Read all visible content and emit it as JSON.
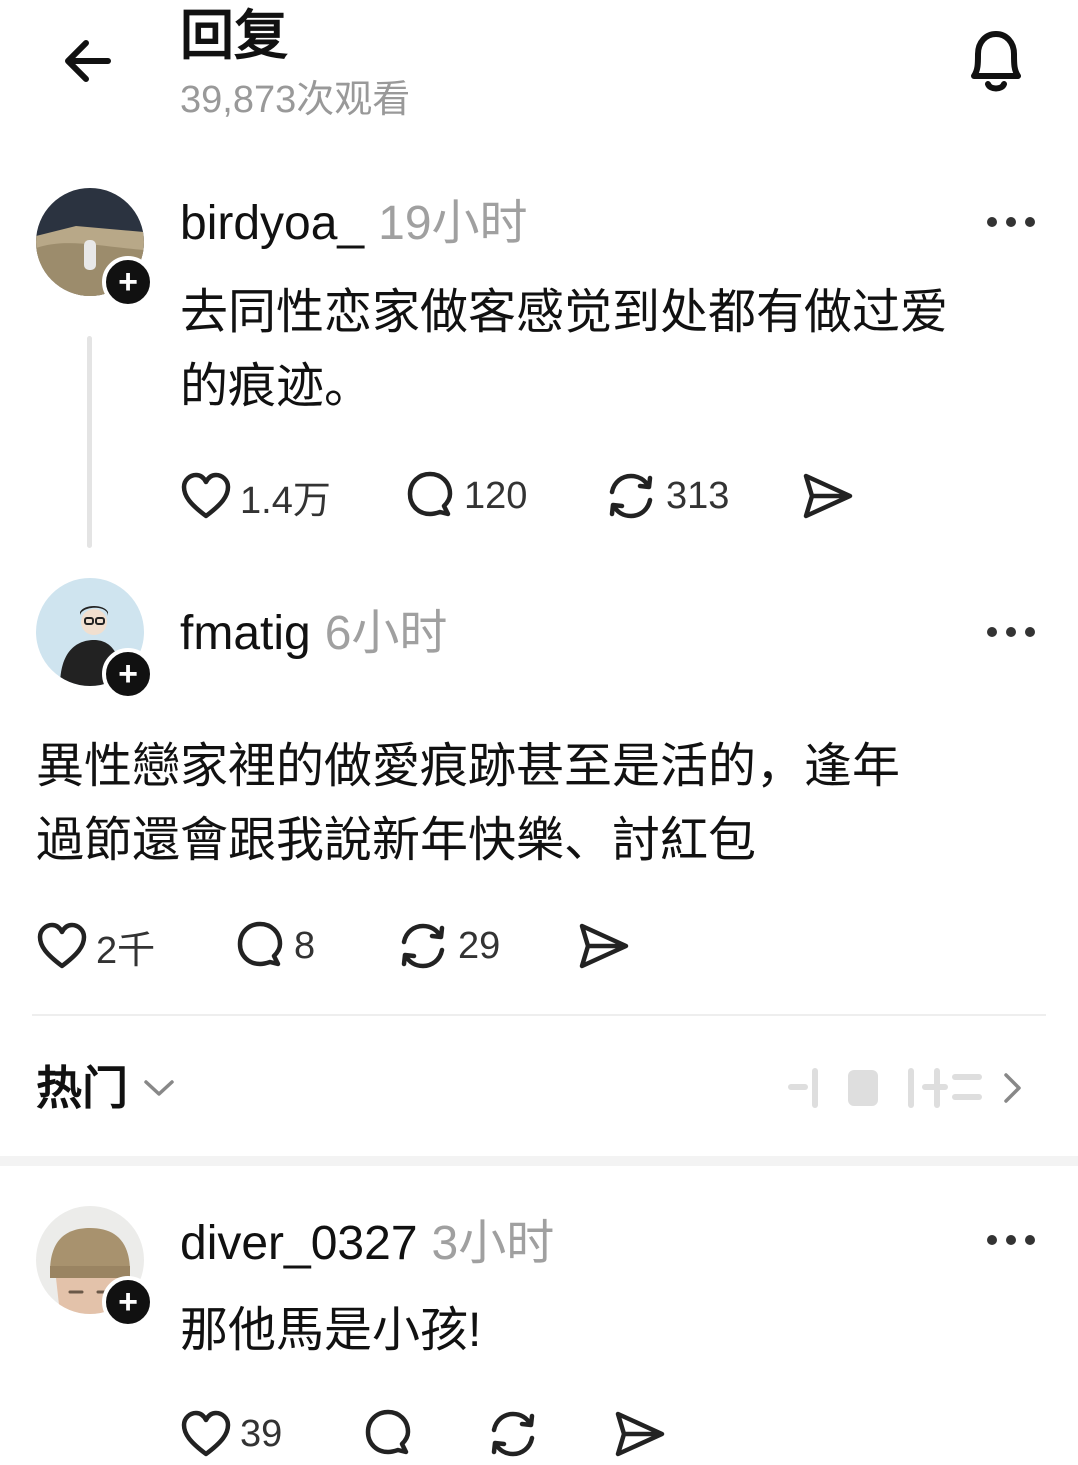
{
  "header": {
    "title": "回复",
    "views": "39,873次观看"
  },
  "posts": [
    {
      "username": "birdyoa_",
      "time": "19小时",
      "text_lines": [
        "去同性恋家做客感觉到处都有做过爱",
        "的痕迹。"
      ],
      "likes": "1.4万",
      "comments": "120",
      "reposts": "313"
    },
    {
      "username": "fmatig",
      "time": "6小时",
      "text_lines": [
        "異性戀家裡的做愛痕跡甚至是活的，逢年",
        "過節還會跟我說新年快樂、討紅包"
      ],
      "likes": "2千",
      "comments": "8",
      "reposts": "29"
    }
  ],
  "sort": {
    "label": "热门"
  },
  "replies": [
    {
      "username": "diver_0327",
      "time": "3小时",
      "text": "那他馬是小孩!",
      "likes": "39"
    }
  ],
  "icons": {
    "back": "back-arrow-icon",
    "bell": "bell-icon",
    "like": "heart-icon",
    "comment": "comment-bubble-icon",
    "repost": "repost-icon",
    "share": "send-icon",
    "more": "more-dots-icon",
    "follow": "plus-icon"
  },
  "colors": {
    "text": "#111111",
    "muted": "#999999",
    "divider": "#eeeeee"
  }
}
